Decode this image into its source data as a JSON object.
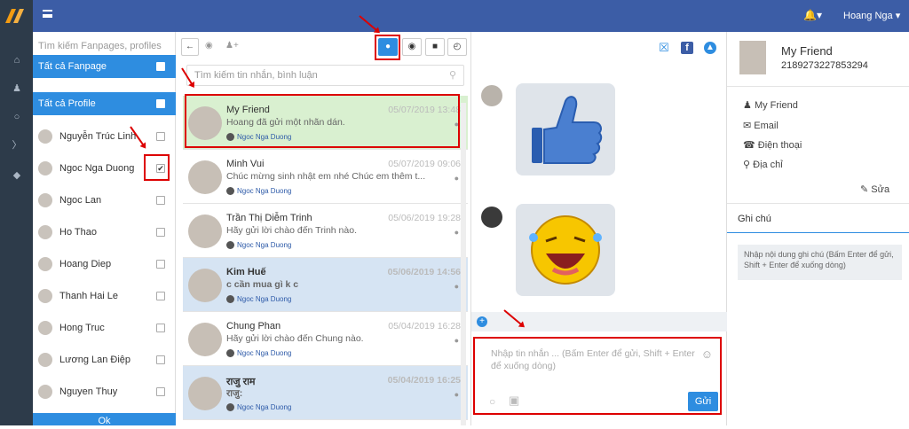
{
  "topbar": {
    "user": "Hoang Nga",
    "bell_icon": "bell-icon"
  },
  "nav": {
    "icons": [
      "home-icon",
      "user-icon",
      "chat-icon",
      "tag-icon",
      "tags-icon"
    ]
  },
  "profiles_panel": {
    "search_placeholder": "Tìm kiếm Fanpages, profiles",
    "all_fanpage": "Tất cả Fanpage",
    "all_profile": "Tất cả Profile",
    "profiles": [
      {
        "name": "Nguyễn Trúc Linh",
        "checked": false
      },
      {
        "name": "Ngoc Nga Duong",
        "checked": true
      },
      {
        "name": "Ngoc Lan",
        "checked": false
      },
      {
        "name": "Ho Thao",
        "checked": false
      },
      {
        "name": "Hoang Diep",
        "checked": false
      },
      {
        "name": "Thanh Hai Le",
        "checked": false
      },
      {
        "name": "Hong Truc",
        "checked": false
      },
      {
        "name": "Lương Lan Điệp",
        "checked": false
      },
      {
        "name": "Nguyen Thuy",
        "checked": false
      }
    ],
    "ok_label": "Ok"
  },
  "conversations": {
    "search_placeholder": "Tìm kiếm tin nhắn, bình luận",
    "items": [
      {
        "name": "My Friend",
        "date": "05/07/2019 13:48",
        "message": "Hoang đã gửi một nhãn dán.",
        "page": "Ngoc Nga Duong",
        "bold": false,
        "bg": "#d9f0d0"
      },
      {
        "name": "Minh Vui",
        "date": "05/07/2019 09:06",
        "message": "Chúc mừng sinh nhật em nhé Chúc em thêm t...",
        "page": "Ngoc Nga Duong",
        "bold": false,
        "bg": "#ffffff"
      },
      {
        "name": "Trần Thị Diễm Trinh",
        "date": "05/06/2019 19:28",
        "message": "Hãy gửi lời chào đến Trinh nào.",
        "page": "Ngoc Nga Duong",
        "bold": false,
        "bg": "#ffffff"
      },
      {
        "name": "Kim Huế",
        "date": "05/06/2019 14:56",
        "message": "c cần mua gì k c",
        "page": "Ngoc Nga Duong",
        "bold": true,
        "bg": "#d6e4f3"
      },
      {
        "name": "Chung Phan",
        "date": "05/04/2019 16:28",
        "message": "Hãy gửi lời chào đến Chung nào.",
        "page": "Ngoc Nga Duong",
        "bold": false,
        "bg": "#ffffff"
      },
      {
        "name": "राजु राम",
        "date": "05/04/2019 16:25",
        "message": "राजु: ",
        "page": "Ngoc Nga Duong",
        "bold": true,
        "bg": "#d6e4f3"
      }
    ]
  },
  "chat": {
    "compose_placeholder": "Nhập tin nhắn ... (Bấm Enter để gửi, Shift + Enter để xuống dòng)",
    "send_label": "Gửi",
    "stickers": [
      "thumbs-up-sticker",
      "laughing-sticker"
    ]
  },
  "contact": {
    "name": "My Friend",
    "id": "2189273227853294",
    "fields": [
      "My Friend",
      "Email",
      "Điện thoại",
      "Địa chỉ"
    ],
    "edit_label": "Sửa",
    "notes_title": "Ghi chú",
    "notes_placeholder": "Nhập nội dung ghi chú (Bấm Enter để gửi, Shift + Enter để xuống dòng)"
  },
  "colors": {
    "topbar": "#3c5da6",
    "accent": "#2e8de0",
    "sidebar": "#2d3b4a",
    "highlight": "#d00000"
  }
}
